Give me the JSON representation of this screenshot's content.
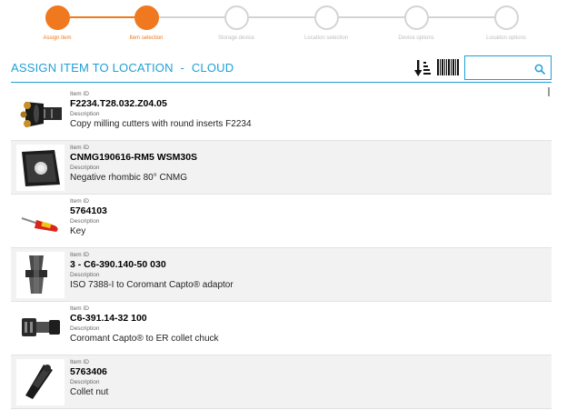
{
  "stepper": {
    "accent": "#f0781e",
    "steps": [
      {
        "label": "Assign item",
        "state": "done"
      },
      {
        "label": "Item selection",
        "state": "done"
      },
      {
        "label": "Storage device",
        "state": "pending"
      },
      {
        "label": "Location selection",
        "state": "pending"
      },
      {
        "label": "Device options",
        "state": "pending"
      },
      {
        "label": "Location options",
        "state": "pending"
      }
    ]
  },
  "header": {
    "title": "ASSIGN ITEM TO LOCATION",
    "separator": "-",
    "context": "CLOUD",
    "title_color": "#1fa0d8",
    "sort_icon": "sort-descending-icon",
    "barcode_icon": "barcode-icon",
    "search": {
      "value": "",
      "placeholder": "",
      "icon": "search-icon"
    }
  },
  "list": {
    "id_caption": "Item ID",
    "desc_caption": "Description",
    "items": [
      {
        "id": "F2234.T28.032.Z04.05",
        "description": "Copy milling cutters with round inserts F2234",
        "thumb_icon": "milling-cutter-icon"
      },
      {
        "id": "CNMG190616-RM5 WSM30S",
        "description": "Negative rhombic 80° CNMG",
        "thumb_icon": "rhombic-insert-icon"
      },
      {
        "id": "5764103",
        "description": "Key",
        "thumb_icon": "screwdriver-key-icon"
      },
      {
        "id": "3 - C6-390.140-50 030",
        "description": "ISO 7388-I to Coromant Capto® adaptor",
        "thumb_icon": "adaptor-icon"
      },
      {
        "id": "C6-391.14-32 100",
        "description": "Coromant Capto® to ER collet chuck",
        "thumb_icon": "collet-chuck-icon"
      },
      {
        "id": "5763406",
        "description": "Collet nut",
        "thumb_icon": "collet-nut-icon"
      }
    ]
  }
}
